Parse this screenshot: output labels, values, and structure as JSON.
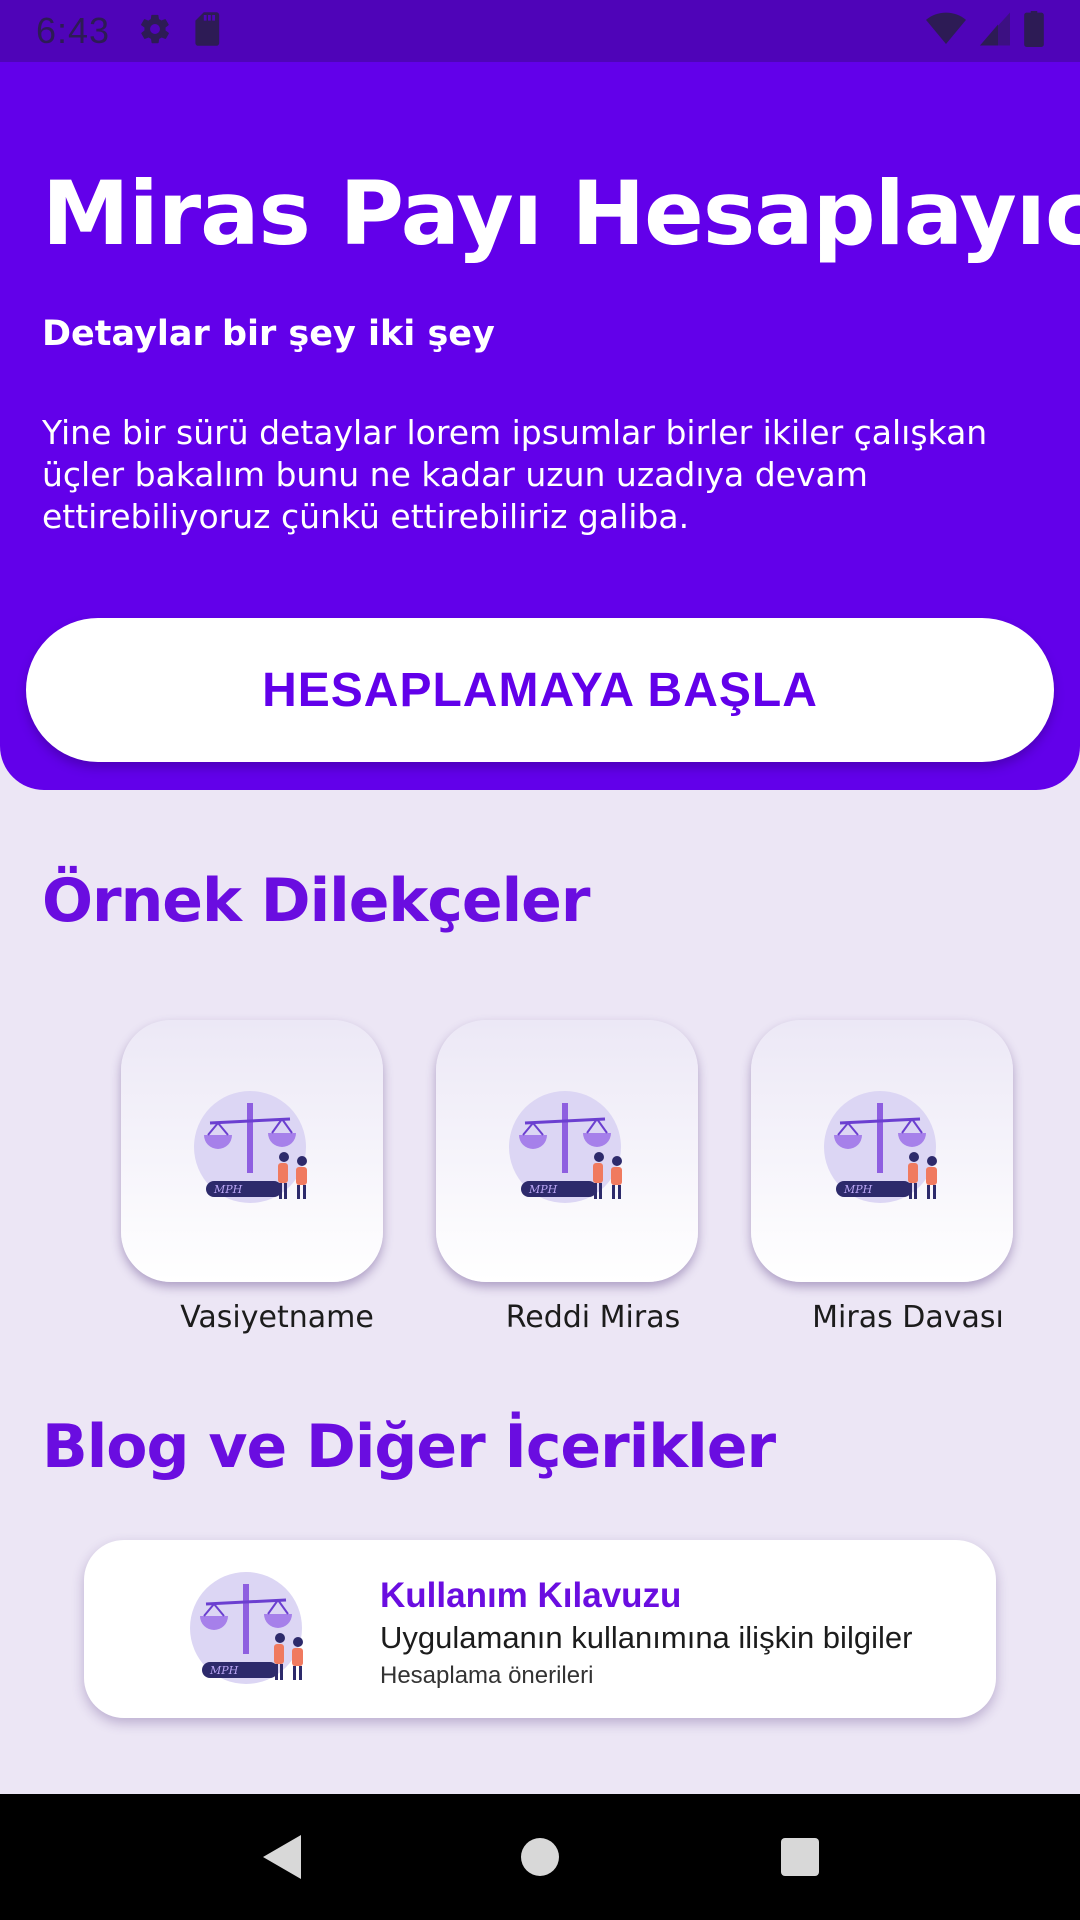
{
  "status_bar": {
    "time": "6:43",
    "left_icons": [
      "gear-icon",
      "sd-card-icon"
    ],
    "right_icons": [
      "wifi-icon",
      "signal-icon",
      "battery-icon"
    ]
  },
  "hero": {
    "title": "Miras Payı Hesaplayıcı",
    "subtitle": "Detaylar bir şey iki şey",
    "description": "Yine bir sürü detaylar lorem ipsumlar birler ikiler çalışkan üçler bakalım bunu ne kadar uzun uzadıya devam ettirebiliyoruz çünkü ettirebiliriz galiba.",
    "button_label": "HESAPLAMAYA BAŞLA"
  },
  "petitions": {
    "title": "Örnek Dilekçeler",
    "items": [
      {
        "label": "Vasiyetname"
      },
      {
        "label": "Reddi Miras"
      },
      {
        "label": "Miras Davası"
      }
    ],
    "logo_text": "MPH"
  },
  "blog": {
    "title": "Blog ve Diğer İçerikler",
    "card": {
      "title": "Kullanım Kılavuzu",
      "subtitle": "Uygulamanın kullanımına ilişkin bilgiler",
      "note": "Hesaplama önerileri"
    }
  },
  "colors": {
    "primary": "#6200ea",
    "status_bar": "#4f04b8",
    "background": "#ece6f5",
    "accent_text": "#6a0de0"
  },
  "nav_bar": {
    "buttons": [
      "back-icon",
      "home-icon",
      "recents-icon"
    ]
  }
}
